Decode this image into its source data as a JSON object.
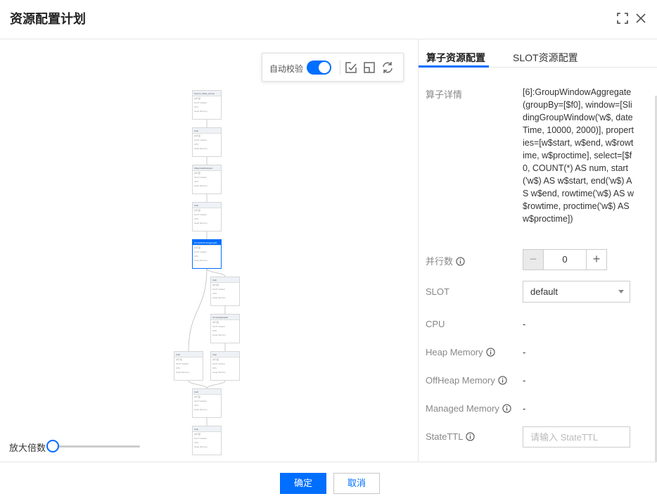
{
  "dialog": {
    "title": "资源配置计划",
    "fullscreen_icon": "fullscreen-icon",
    "close_icon": "close-icon"
  },
  "toolbar": {
    "auto_check_label": "自动校验",
    "auto_check_on": true,
    "icons": [
      "fit-view-icon",
      "expand-icon",
      "refresh-icon"
    ]
  },
  "zoom": {
    "label": "放大倍数",
    "level": 0
  },
  "graph": {
    "nodes": [
      {
        "title": "Source: kafka_source",
        "active": false
      },
      {
        "title": "Calc",
        "active": false
      },
      {
        "title": "WatermarkAssigner",
        "active": false
      },
      {
        "title": "Calc",
        "active": false
      },
      {
        "title": "GroupWindowAggregate",
        "active": true
      },
      {
        "title": "Calc",
        "active": false
      },
      {
        "title": "GroupAggregate",
        "active": false
      },
      {
        "title": "Calc",
        "active": false
      },
      {
        "title": "Calc",
        "active": false
      },
      {
        "title": "Calc",
        "active": false
      },
      {
        "title": "Calc",
        "active": false
      }
    ],
    "row_labels": [
      "并行度",
      "SLOT",
      "CPU",
      "Heap Memory"
    ],
    "row_value": "default"
  },
  "panel": {
    "tabs": [
      {
        "label": "算子资源配置",
        "active": true
      },
      {
        "label": "SLOT资源配置",
        "active": false
      }
    ],
    "detail_label": "算子详情",
    "detail_value": "[6]:GroupWindowAggregate(groupBy=[$f0], window=[SlidingGroupWindow('w$, dateTime, 10000, 2000)], properties=[w$start, w$end, w$rowtime, w$proctime], select=[$f0, COUNT(*) AS num, start('w$) AS w$start, end('w$) AS w$end, rowtime('w$) AS w$rowtime, proctime('w$) AS w$proctime])",
    "parallelism_label": "并行数",
    "parallelism_value": "0",
    "slot_label": "SLOT",
    "slot_value": "default",
    "cpu_label": "CPU",
    "cpu_value": "-",
    "heap_label": "Heap Memory",
    "heap_value": "-",
    "offheap_label": "OffHeap Memory",
    "offheap_value": "-",
    "managed_label": "Managed Memory",
    "managed_value": "-",
    "ttl_label": "StateTTL",
    "ttl_placeholder": "请输入 StateTTL"
  },
  "footer": {
    "confirm_label": "确定",
    "cancel_label": "取消"
  },
  "colors": {
    "primary": "#006eff"
  }
}
